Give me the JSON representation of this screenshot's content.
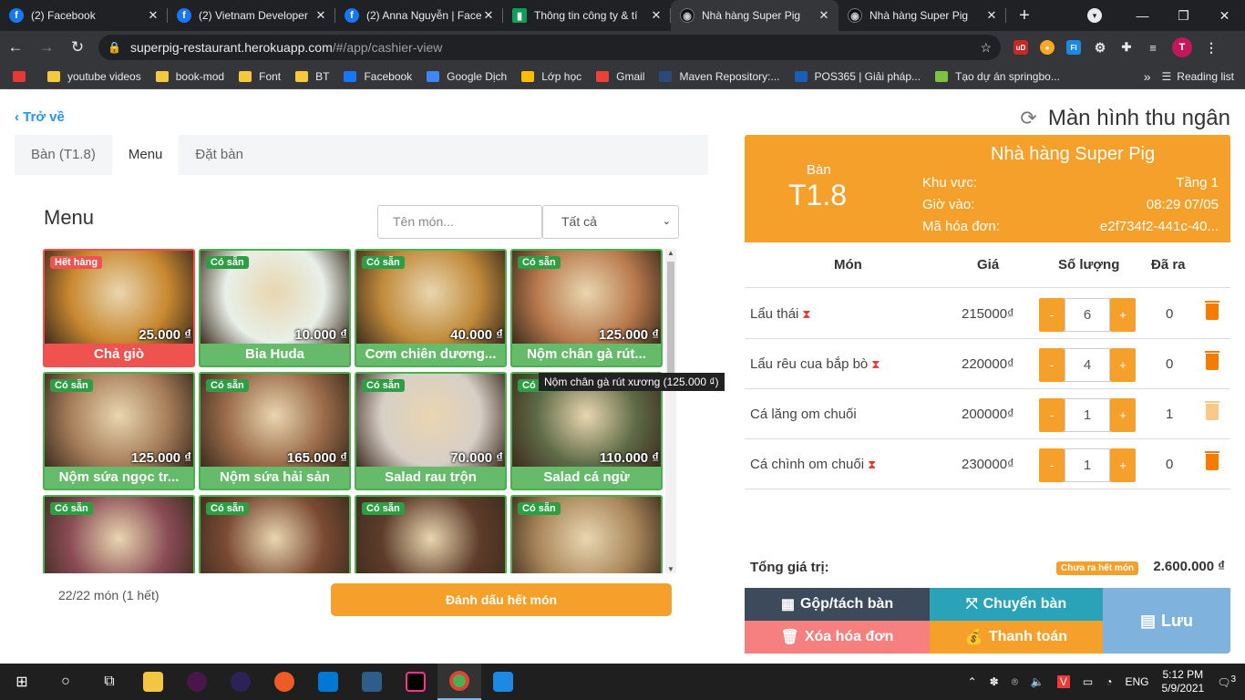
{
  "browser": {
    "tabs": [
      {
        "title": "(2) Facebook",
        "icon": "facebook-icon",
        "active": false
      },
      {
        "title": "(2) Vietnam Developer",
        "icon": "facebook-icon",
        "active": false
      },
      {
        "title": "(2) Anna Nguyễn | Face",
        "icon": "facebook-icon",
        "active": false
      },
      {
        "title": "Thông tin công ty & tí",
        "icon": "sheet-icon",
        "active": false
      },
      {
        "title": "Nhà hàng Super Pig",
        "icon": "pig-icon",
        "active": true
      },
      {
        "title": "Nhà hàng Super Pig",
        "icon": "pig-icon",
        "active": false
      }
    ],
    "url_host": "superpig-restaurant.herokuapp.com",
    "url_path": "/#/app/cashier-view",
    "bookmarks": [
      "youtube videos",
      "book-mod",
      "Font",
      "BT",
      "Facebook",
      "Google Dịch",
      "Lớp học",
      "Gmail",
      "Maven Repository:...",
      "POS365 | Giải pháp...",
      "Tạo dự án springbo..."
    ],
    "reading_list": "Reading list",
    "more": "»"
  },
  "header": {
    "back": "Trở về",
    "title": "Màn hình thu ngân"
  },
  "left": {
    "tabs": [
      "Bàn (T1.8)",
      "Menu",
      "Đặt bàn"
    ],
    "menu_title": "Menu",
    "search_placeholder": "Tên món...",
    "filter_value": "Tất cả",
    "items": [
      {
        "name": "Chả giò",
        "price": "25.000 ₫",
        "status": "Hết hàng",
        "out": true,
        "color": "#c9882f"
      },
      {
        "name": "Bia Huda",
        "price": "10.000 ₫",
        "status": "Có sẵn",
        "out": false,
        "color": "#e8f0e8"
      },
      {
        "name": "Cơm chiên dương...",
        "price": "40.000 ₫",
        "status": "Có sẵn",
        "out": false,
        "color": "#c08a3a"
      },
      {
        "name": "Nộm chân gà rút...",
        "price": "125.000 ₫",
        "status": "Có sẵn",
        "out": false,
        "color": "#b97a4d"
      },
      {
        "name": "Nộm sứa ngọc tr...",
        "price": "125.000 ₫",
        "status": "Có sẵn",
        "out": false,
        "color": "#a67d5a"
      },
      {
        "name": "Nộm sứa hải sản",
        "price": "165.000 ₫",
        "status": "Có sẵn",
        "out": false,
        "color": "#9a6b4a"
      },
      {
        "name": "Salad rau trộn",
        "price": "70.000 ₫",
        "status": "Có sẵn",
        "out": false,
        "color": "#d7cfc7"
      },
      {
        "name": "Salad cá ngừ",
        "price": "110.000 ₫",
        "status": "Có sẵn",
        "out": false,
        "color": "#5e6b47"
      },
      {
        "name": "",
        "price": "",
        "status": "Có sẵn",
        "out": false,
        "color": "#8a4c56"
      },
      {
        "name": "",
        "price": "",
        "status": "Có sẵn",
        "out": false,
        "color": "#7a4a33"
      },
      {
        "name": "",
        "price": "",
        "status": "Có sẵn",
        "out": false,
        "color": "#5d3c2a"
      },
      {
        "name": "",
        "price": "",
        "status": "Có sẵn",
        "out": false,
        "color": "#a8865a"
      }
    ],
    "tooltip": "Nộm chân gà rút xương (125.000 ₫)",
    "count": "22/22 món (1 hết)",
    "mark_button": "Đánh dấu hết món"
  },
  "right": {
    "restaurant": "Nhà hàng Super Pig",
    "table_label": "Bàn",
    "table_value": "T1.8",
    "area_label": "Khu vực:",
    "area_value": "Tầng 1",
    "time_label": "Giờ vào:",
    "time_value": "08:29 07/05",
    "invoice_label": "Mã hóa đơn:",
    "invoice_value": "e2f734f2-441c-40...",
    "columns": [
      "Món",
      "Giá",
      "Số lượng",
      "Đã ra"
    ],
    "orders": [
      {
        "name": "Lẩu thái",
        "pending": true,
        "price": "215000₫",
        "qty": "6",
        "served": "0"
      },
      {
        "name": "Lẩu rêu cua bắp bò",
        "pending": true,
        "price": "220000₫",
        "qty": "4",
        "served": "0"
      },
      {
        "name": "Cá lăng om chuối",
        "pending": false,
        "price": "200000₫",
        "qty": "1",
        "served": "1"
      },
      {
        "name": "Cá chình om chuối",
        "pending": true,
        "price": "230000₫",
        "qty": "1",
        "served": "0"
      }
    ],
    "total_label": "Tổng giá trị:",
    "pending_badge": "Chưa ra hết món",
    "total_value": "2.600.000 ₫",
    "buttons": {
      "merge": "Gộp/tách bàn",
      "move": "Chuyển bàn",
      "delete": "Xóa hóa đơn",
      "pay": "Thanh toán",
      "save": "Lưu"
    }
  },
  "taskbar": {
    "lang": "ENG",
    "time": "5:12 PM",
    "date": "5/9/2021",
    "notif": "3"
  }
}
